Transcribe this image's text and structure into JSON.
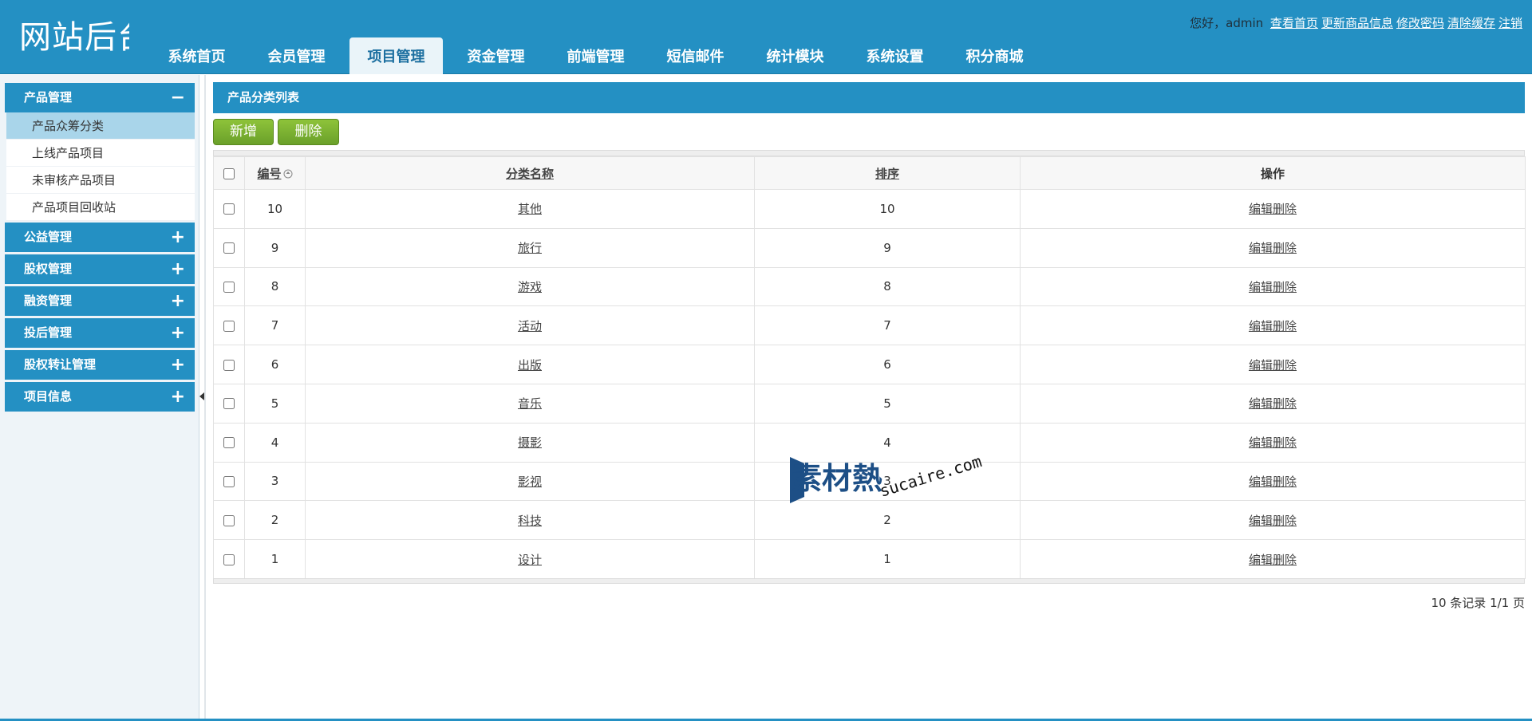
{
  "header": {
    "logo_text": "网站后台",
    "greeting": "您好，admin",
    "links": [
      "查看首页",
      "更新商品信息",
      "修改密码",
      "清除缓存",
      "注销"
    ]
  },
  "nav": {
    "tabs": [
      "系统首页",
      "会员管理",
      "项目管理",
      "资金管理",
      "前端管理",
      "短信邮件",
      "统计模块",
      "系统设置",
      "积分商城"
    ],
    "active": "项目管理"
  },
  "sidebar": {
    "open_group": {
      "label": "产品管理",
      "sign": "−"
    },
    "items": [
      "产品众筹分类",
      "上线产品项目",
      "未审核产品项目",
      "产品项目回收站"
    ],
    "active_item": "产品众筹分类",
    "groups": [
      {
        "label": "公益管理",
        "sign": "+"
      },
      {
        "label": "股权管理",
        "sign": "+"
      },
      {
        "label": "融资管理",
        "sign": "+"
      },
      {
        "label": "投后管理",
        "sign": "+"
      },
      {
        "label": "股权转让管理",
        "sign": "+"
      },
      {
        "label": "项目信息",
        "sign": "+"
      }
    ]
  },
  "main": {
    "panel_title": "产品分类列表",
    "add_button": "新增",
    "delete_button": "删除",
    "columns": [
      "编号",
      "分类名称",
      "排序",
      "操作"
    ],
    "rows": [
      {
        "id": "10",
        "name": "其他",
        "order": "10"
      },
      {
        "id": "9",
        "name": "旅行",
        "order": "9"
      },
      {
        "id": "8",
        "name": "游戏",
        "order": "8"
      },
      {
        "id": "7",
        "name": "活动",
        "order": "7"
      },
      {
        "id": "6",
        "name": "出版",
        "order": "6"
      },
      {
        "id": "5",
        "name": "音乐",
        "order": "5"
      },
      {
        "id": "4",
        "name": "摄影",
        "order": "4"
      },
      {
        "id": "3",
        "name": "影视",
        "order": "3"
      },
      {
        "id": "2",
        "name": "科技",
        "order": "2"
      },
      {
        "id": "1",
        "name": "设计",
        "order": "1"
      }
    ],
    "row_actions": {
      "edit": "编辑",
      "delete": "删除"
    },
    "pager": "10 条记录 1/1 页"
  },
  "watermark": {
    "brand": "素材熱",
    "domain": "sucaire.com"
  },
  "colors": {
    "primary": "#2490c3",
    "active_item": "#a9d5ea",
    "button_green": "#7cb233"
  }
}
